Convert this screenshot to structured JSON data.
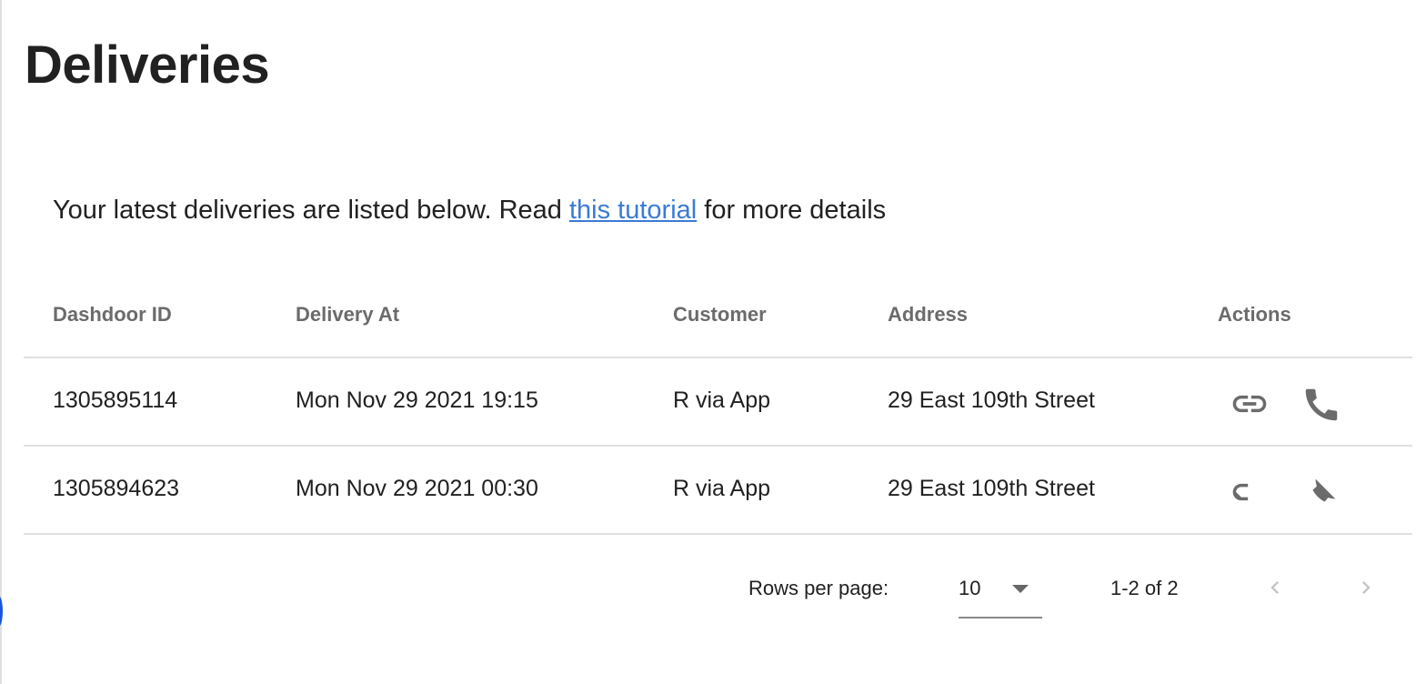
{
  "page": {
    "title": "Deliveries"
  },
  "intro": {
    "before": "Your latest deliveries are listed below. Read ",
    "link": "this tutorial",
    "after": " for more details"
  },
  "table": {
    "columns": [
      "Dashdoor ID",
      "Delivery At",
      "Customer",
      "Address",
      "Actions"
    ],
    "rows": [
      {
        "id": "1305895114",
        "delivery_at": "Mon Nov 29 2021 19:15",
        "customer": "R via App",
        "address": "29 East 109th Street",
        "actions": [
          "link-icon",
          "phone-icon"
        ]
      },
      {
        "id": "1305894623",
        "delivery_at": "Mon Nov 29 2021 00:30",
        "customer": "R via App",
        "address": "29 East 109th Street",
        "actions": [
          "link-icon",
          "phone-icon"
        ]
      }
    ]
  },
  "pagination": {
    "rows_per_page_label": "Rows per page:",
    "rows_per_page": "10",
    "range": "1-2 of 2"
  },
  "colors": {
    "link": "#3a7bd5",
    "icon": "#6b6b6b",
    "divider": "#e0e0e0"
  }
}
